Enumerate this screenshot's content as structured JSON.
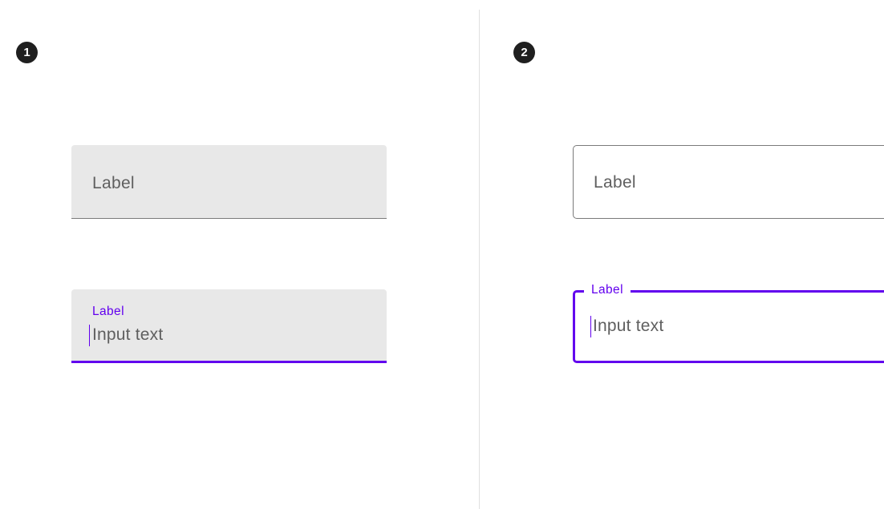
{
  "markers": {
    "first": "1",
    "second": "2"
  },
  "filled": {
    "inactive": {
      "label": "Label"
    },
    "active": {
      "label": "Label",
      "value": "Input text"
    }
  },
  "outlined": {
    "inactive": {
      "label": "Label"
    },
    "active": {
      "label": "Label",
      "value": "Input text"
    }
  },
  "colors": {
    "accent": "#6200ee",
    "field_fill": "#e8e8e8",
    "badge": "#1f1f1f",
    "text": "#5f5f5f",
    "divider": "#e0e0e0"
  }
}
